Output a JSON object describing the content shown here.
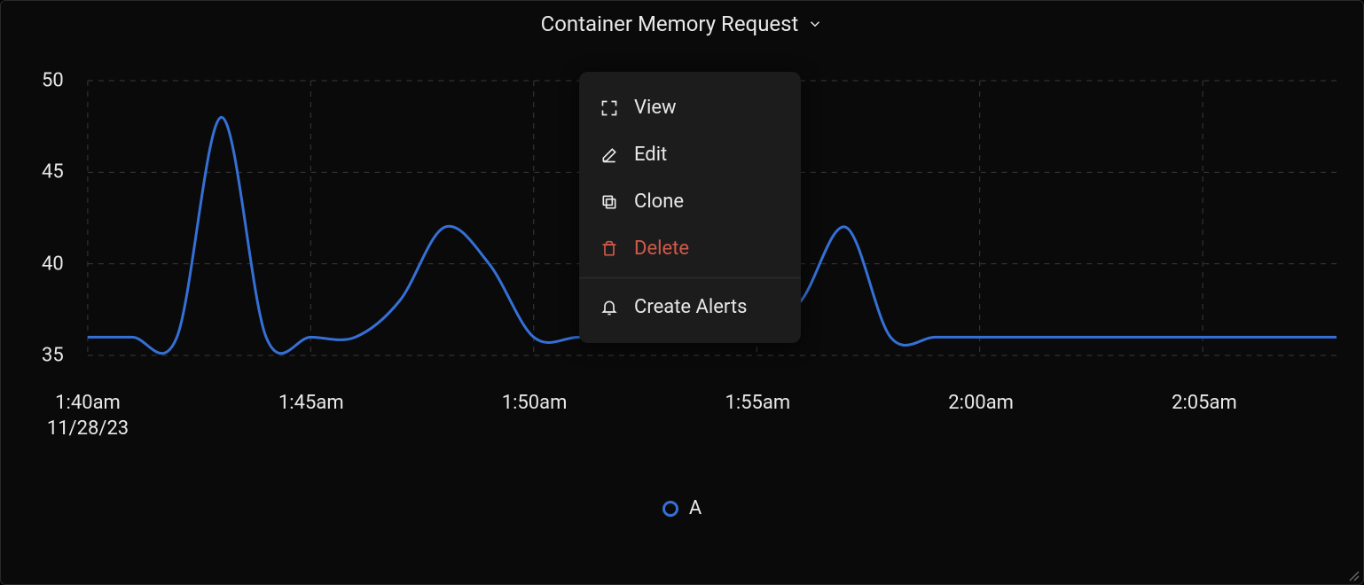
{
  "title": "Container Memory Request",
  "date_label": "11/28/23",
  "legend": {
    "series_a": "A"
  },
  "colors": {
    "series": "#3570d6",
    "danger": "#d05a4a",
    "grid": "#3a3a3a",
    "bg": "#0a0a0a"
  },
  "menu": {
    "view": "View",
    "edit": "Edit",
    "clone": "Clone",
    "delete": "Delete",
    "alerts": "Create Alerts"
  },
  "chart_data": {
    "type": "line",
    "title": "Container Memory Request",
    "xlabel": "",
    "ylabel": "",
    "ylim": [
      35,
      50
    ],
    "y_ticks": [
      35,
      40,
      45,
      50
    ],
    "x_ticks": [
      "1:40am",
      "1:45am",
      "1:50am",
      "1:55am",
      "2:00am",
      "2:05am"
    ],
    "x_date": "11/28/23",
    "series": [
      {
        "name": "A",
        "color": "#3570d6",
        "points": [
          {
            "t": "1:40am",
            "v": 36
          },
          {
            "t": "1:41am",
            "v": 36
          },
          {
            "t": "1:42am",
            "v": 36
          },
          {
            "t": "1:43am",
            "v": 48
          },
          {
            "t": "1:44am",
            "v": 36
          },
          {
            "t": "1:45am",
            "v": 36
          },
          {
            "t": "1:46am",
            "v": 36
          },
          {
            "t": "1:47am",
            "v": 38
          },
          {
            "t": "1:48am",
            "v": 42
          },
          {
            "t": "1:49am",
            "v": 40
          },
          {
            "t": "1:50am",
            "v": 36
          },
          {
            "t": "1:51am",
            "v": 36
          },
          {
            "t": "1:52am",
            "v": 36
          },
          {
            "t": "1:53am",
            "v": 36
          },
          {
            "t": "1:54am",
            "v": 36
          },
          {
            "t": "1:55am",
            "v": 36
          },
          {
            "t": "1:56am",
            "v": 38
          },
          {
            "t": "1:57am",
            "v": 42
          },
          {
            "t": "1:58am",
            "v": 36
          },
          {
            "t": "1:59am",
            "v": 36
          },
          {
            "t": "2:00am",
            "v": 36
          },
          {
            "t": "2:01am",
            "v": 36
          },
          {
            "t": "2:02am",
            "v": 36
          },
          {
            "t": "2:03am",
            "v": 36
          },
          {
            "t": "2:04am",
            "v": 36
          },
          {
            "t": "2:05am",
            "v": 36
          },
          {
            "t": "2:06am",
            "v": 36
          },
          {
            "t": "2:07am",
            "v": 36
          },
          {
            "t": "2:08am",
            "v": 36
          }
        ]
      }
    ]
  }
}
